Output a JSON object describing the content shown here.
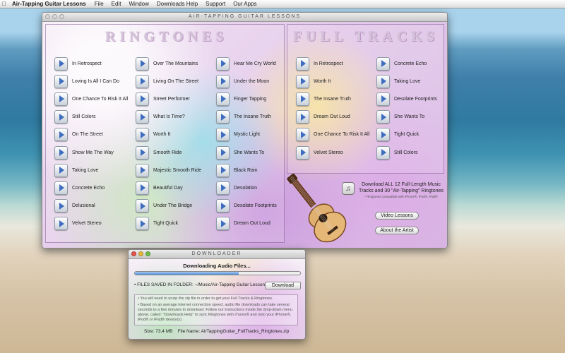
{
  "menubar": {
    "app_name": "Air-Tapping Guitar Lessons",
    "items": [
      "File",
      "Edit",
      "Window",
      "Downloads Help",
      "Support",
      "Our Apps"
    ]
  },
  "main_window": {
    "title": "AIR-TAPPING GUITAR LESSONS",
    "ringtones_heading": "RINGTONES",
    "full_tracks_heading": "FULL TRACKS",
    "ringtones_columns": [
      [
        "In Retrospect",
        "Loving Is All I Can Do",
        "One Chance To Risk It All",
        "Still Colors",
        "On The Street",
        "Show Me The Way",
        "Taking Love",
        "Concrete Echo",
        "Delusional",
        "Velvet Stereo"
      ],
      [
        "Over The Mountains",
        "Living On The Street",
        "Street Performer",
        "What Is Time?",
        "Worth It",
        "Smooth Ride",
        "Majestic Smooth Ride",
        "Beautiful Day",
        "Under The Bridge",
        "Tight Quick"
      ],
      [
        "Hear Me Cry World",
        "Under the Moon",
        "Finger Tapping",
        "The Insane Truth",
        "Mystic Light",
        "She Wants To",
        "Black Rain",
        "Desolation",
        "Desolate Footprints",
        "Dream Out Loud"
      ]
    ],
    "full_tracks_columns": [
      [
        "In Retrospect",
        "Worth It",
        "The Insane Truth",
        "Dream Out Loud",
        "One Chance To Risk It All",
        "Velvet Stereo"
      ],
      [
        "Concrete Echo",
        "Taking Love",
        "Desolate Footprints",
        "She Wants To",
        "Tight Quick",
        "Still Colors"
      ]
    ],
    "download_all_text": "Download ALL 12 Full-Length Music Tracks and 30 \"Air-Tapping\" Ringtones",
    "download_all_note": "* Ringtones compatible with iPhone®, iPod®, iPad®",
    "video_lessons_label": "Video Lessons",
    "about_artist_label": "About the Artist"
  },
  "downloader": {
    "title": "DOWNLOADER",
    "status": "Downloading Audio Files...",
    "progress_fraction": 0.63,
    "folder_label": "• FILES SAVED IN FOLDER:",
    "folder_path": "~/Music/Air-Tapping Guitar Lessons",
    "download_label": "Download",
    "info_lines": [
      "• You will need to unzip the zip file in order to get your Full Tracks & Ringtones.",
      "• Based on an average internet connection speed, audio file downloads can take several seconds to a few minutes to download. Follow our instructions inside the drop-down menu above, called: \"Downloads Help\" to sync Ringtones with iTunes® and onto your iPhone®, iPod® or iPad® device(s)."
    ],
    "size_label": "Size:",
    "size_value": "73.4 MB",
    "file_name_label": "File Name:",
    "file_name_value": "AirTappingGuitar_FullTracks_Ringtones.zip"
  }
}
